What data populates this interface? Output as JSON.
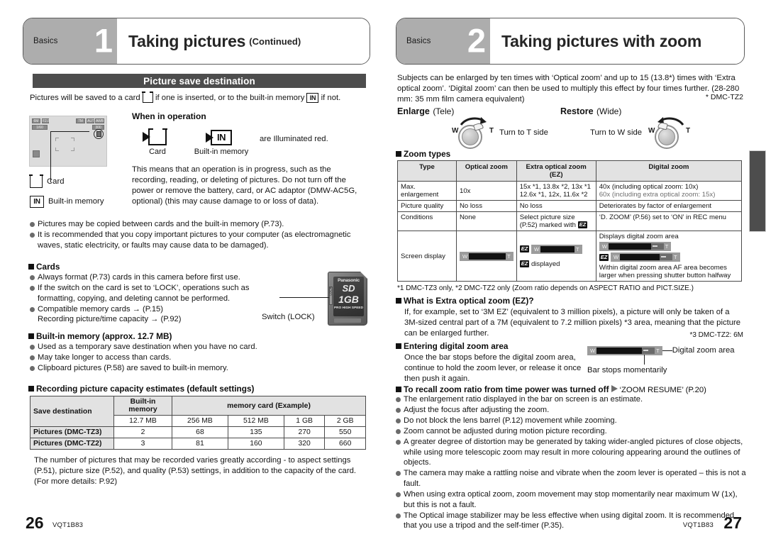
{
  "left_page": {
    "header": {
      "section_label": "Basics",
      "chapter_number": "1",
      "title": "Taking pictures",
      "title_suffix": "(Continued)"
    },
    "section_bar": "Picture save destination",
    "intro_before_card": "Pictures will be saved to a card",
    "intro_middle": "if one is inserted, or to the built-in memory",
    "intro_end": "if not.",
    "lcd_labels": {
      "card": "Card",
      "built_in_memory": "Built-in memory",
      "top_left_1": "6M",
      "top_left_2": "F2.8",
      "top_left_3": "1/60",
      "top_right_1": "7M",
      "top_right_2": "AUTO",
      "top_right_3": "AWB",
      "counter": "300"
    },
    "when_in_operation": {
      "heading": "When in operation",
      "card_label": "Card",
      "builtin_label": "Built-in memory",
      "illuminated_text": "are Illuminated red.",
      "paragraph": "This means that an operation is in progress, such as the recording, reading, or deleting of pictures. Do not turn off the power or remove the battery, card, or AC adaptor (DMW-AC5G, optional) (this may cause damage to or loss of data)."
    },
    "notes": [
      "Pictures may be copied between cards and the built-in memory (P.73).",
      "It is recommended that you copy important pictures to your computer (as electromagnetic waves, static electricity, or faults may cause data to be damaged)."
    ],
    "cards_section": {
      "heading": "Cards",
      "items": [
        "Always format (P.73) cards in this camera before first use.",
        "If the switch on the card is set to ‘LOCK’, operations such as formatting, copying, and deleting cannot be performed.",
        "Compatible memory cards → (P.15)\nRecording picture/time capacity → (P.92)"
      ],
      "switch_label": "Switch (LOCK)",
      "sd_card": {
        "brand": "Panasonic",
        "logo": "SD",
        "capacity": "1GB",
        "speed": "PRO HIGH SPEED",
        "lock_text": "LOCK"
      }
    },
    "builtin_section": {
      "heading": "Built-in memory (approx. 12.7 MB)",
      "items": [
        "Used as a temporary save destination when you have no card.",
        "May take longer to access than cards.",
        "Clipboard pictures (P.58) are saved to built-in memory."
      ]
    },
    "capacity_section": {
      "heading": "Recording picture capacity estimates (default settings)",
      "table": {
        "row1_header_col1": "Save destination",
        "row1_header_col2": "Built-in memory",
        "row1_header_col3": "memory card (Example)",
        "sizes": [
          "12.7 MB",
          "256 MB",
          "512 MB",
          "1 GB",
          "2 GB"
        ],
        "rows": [
          {
            "label": "Pictures (DMC-TZ3)",
            "values": [
              "2",
              "68",
              "135",
              "270",
              "550"
            ]
          },
          {
            "label": "Pictures (DMC-TZ2)",
            "values": [
              "3",
              "81",
              "160",
              "320",
              "660"
            ]
          }
        ]
      },
      "footnote": "The number of pictures that may be recorded varies greatly according - to aspect settings (P.51), picture size (P.52), and quality (P.53) settings, in addition to the capacity of the card. (For more details: P.92)"
    },
    "footer": {
      "page_number": "26",
      "doc_code": "VQT1B83"
    }
  },
  "right_page": {
    "header": {
      "section_label": "Basics",
      "chapter_number": "2",
      "title": "Taking pictures with zoom",
      "title_suffix": ""
    },
    "intro": "Subjects can be enlarged by ten times with ‘Optical zoom’ and up to 15 (13.8*) times with ‘Extra optical zoom’. ‘Digital zoom’ can then be used to multiply this effect by four times further. (28-280 mm: 35 mm film camera equivalent)",
    "intro_footnote": "* DMC-TZ2",
    "enlarge": {
      "title_bold": "Enlarge",
      "title_light": "(Tele)",
      "instruction": "Turn to T side",
      "w_label": "W",
      "t_label": "T"
    },
    "restore": {
      "title_bold": "Restore",
      "title_light": "(Wide)",
      "instruction": "Turn to W side",
      "w_label": "W",
      "t_label": "T"
    },
    "zoom_types": {
      "heading": "Zoom types",
      "columns": [
        "Type",
        "Optical zoom",
        "Extra optical zoom (EZ)",
        "Digital zoom"
      ],
      "rows": [
        {
          "type": "Max. enlargement",
          "optical": "10x",
          "ez_line1": "15x *1, 13.8x *2, 13x *1",
          "ez_line2": "12.6x *1, 12x, 11.6x *2",
          "digital_line1": "40x (including optical zoom: 10x)",
          "digital_line2": "60x (including extra optical zoom: 15x)"
        },
        {
          "type": "Picture quality",
          "optical": "No loss",
          "ez": "No loss",
          "digital": "Deteriorates by factor of enlargement"
        },
        {
          "type": "Conditions",
          "optical": "None",
          "ez_pre": "Select picture size (P.52) marked with",
          "digital": "‘D. ZOOM’ (P.56) set to ‘ON’ in REC menu"
        },
        {
          "type": "Screen display",
          "ez_caption": "displayed",
          "digital_caption_top": "Displays digital zoom area",
          "digital_caption_bottom": "Within digital zoom area AF area becomes larger when pressing shutter button halfway"
        }
      ],
      "footnote": "*1 DMC-TZ3 only, *2 DMC-TZ2 only (Zoom ratio depends on ASPECT RATIO and PICT.SIZE.)"
    },
    "ez_section": {
      "heading": "What is Extra optical zoom (EZ)?",
      "body": "If, for example, set to ‘3M EZ’ (equivalent to 3 million pixels), a picture will only be taken of a 3M-sized central part of a 7M (equivalent to 7.2 million pixels) *3 area, meaning that the picture can be enlarged further.",
      "footnote": "*3 DMC-TZ2: 6M"
    },
    "entering_dz": {
      "heading": "Entering digital zoom area",
      "body": "Once the bar stops before the digital zoom area, continue to hold the zoom lever, or release it once then push it again.",
      "label_area": "Digital zoom area",
      "label_stop": "Bar stops momentarily"
    },
    "recall": {
      "heading": "To recall zoom ratio from time power was turned off",
      "target": "‘ZOOM RESUME’ (P.20)"
    },
    "notes": [
      "The enlargement ratio displayed in the bar on screen is an estimate.",
      "Adjust the focus after adjusting the zoom.",
      "Do not block the lens barrel (P.12) movement while zooming.",
      "Zoom cannot be adjusted during motion picture recording.",
      "A greater degree of distortion may be generated by taking wider-angled pictures of close objects, while using more telescopic zoom may result in more colouring appearing around the outlines of objects.",
      "The camera may make a rattling noise and vibrate when the zoom lever is operated – this is not a fault.",
      "When using extra optical zoom, zoom movement may stop momentarily near maximum W (1x), but this is not a fault.",
      "The Optical image stabilizer may be less effective when using digital zoom. It is recommended that you use a tripod and the self-timer (P.35)."
    ],
    "footer": {
      "page_number": "27",
      "doc_code": "VQT1B83"
    }
  },
  "icons": {
    "card": "card-icon",
    "built_in_memory": "in-memory-icon",
    "ez_badge": "ez-badge-icon",
    "arrow_right": "right-arrow-icon",
    "zoom_lever": "zoom-lever-icon"
  },
  "colors": {
    "header_gray": "#adadad",
    "section_bar": "#4d4d4d",
    "table_header": "#e2e2e2",
    "bullet": "#6b6b6b",
    "page_bg": "#ffffff"
  }
}
